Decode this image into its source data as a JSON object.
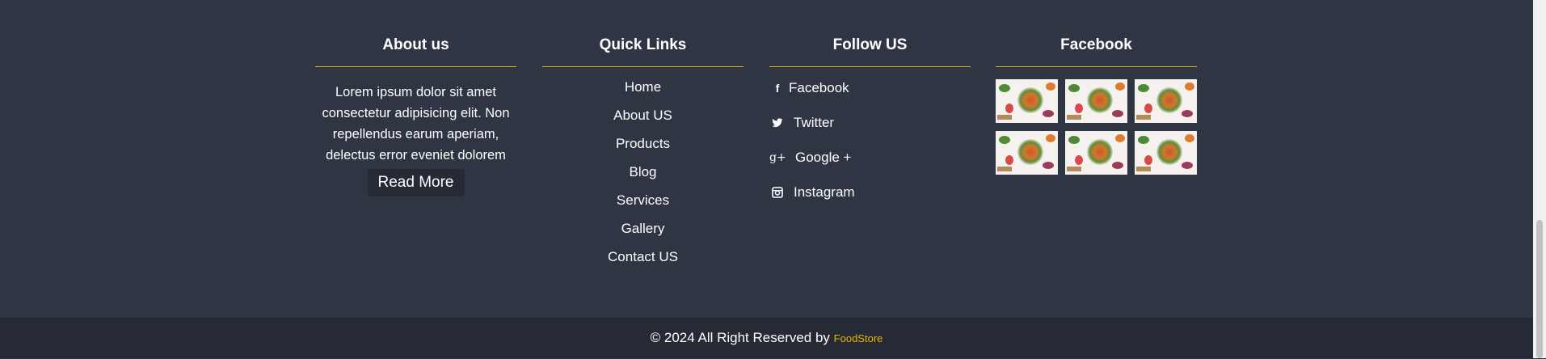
{
  "about": {
    "title": "About us",
    "text": "Lorem ipsum dolor sit amet consectetur adipisicing elit. Non repellendus earum aperiam, delectus error eveniet dolorem",
    "button": "Read More"
  },
  "quick_links": {
    "title": "Quick Links",
    "items": [
      "Home",
      "About US",
      "Products",
      "Blog",
      "Services",
      "Gallery",
      "Contact US"
    ]
  },
  "follow": {
    "title": "Follow US",
    "items": [
      {
        "icon": "facebook-icon",
        "glyph": "f",
        "label": "Facebook"
      },
      {
        "icon": "twitter-icon",
        "glyph": "🐦",
        "label": "Twitter"
      },
      {
        "icon": "google-plus-icon",
        "glyph": "g+",
        "label": "Google +"
      },
      {
        "icon": "instagram-icon",
        "glyph": "◙",
        "label": "Instagram"
      }
    ]
  },
  "facebook": {
    "title": "Facebook",
    "images": 6
  },
  "footer": {
    "copyright": "© 2024 All Right Reserved by",
    "brand": "FoodStore"
  },
  "colors": {
    "background": "#2f3542",
    "bottom_bar": "#252a34",
    "accent": "#e6b800",
    "text": "#ffffff"
  }
}
